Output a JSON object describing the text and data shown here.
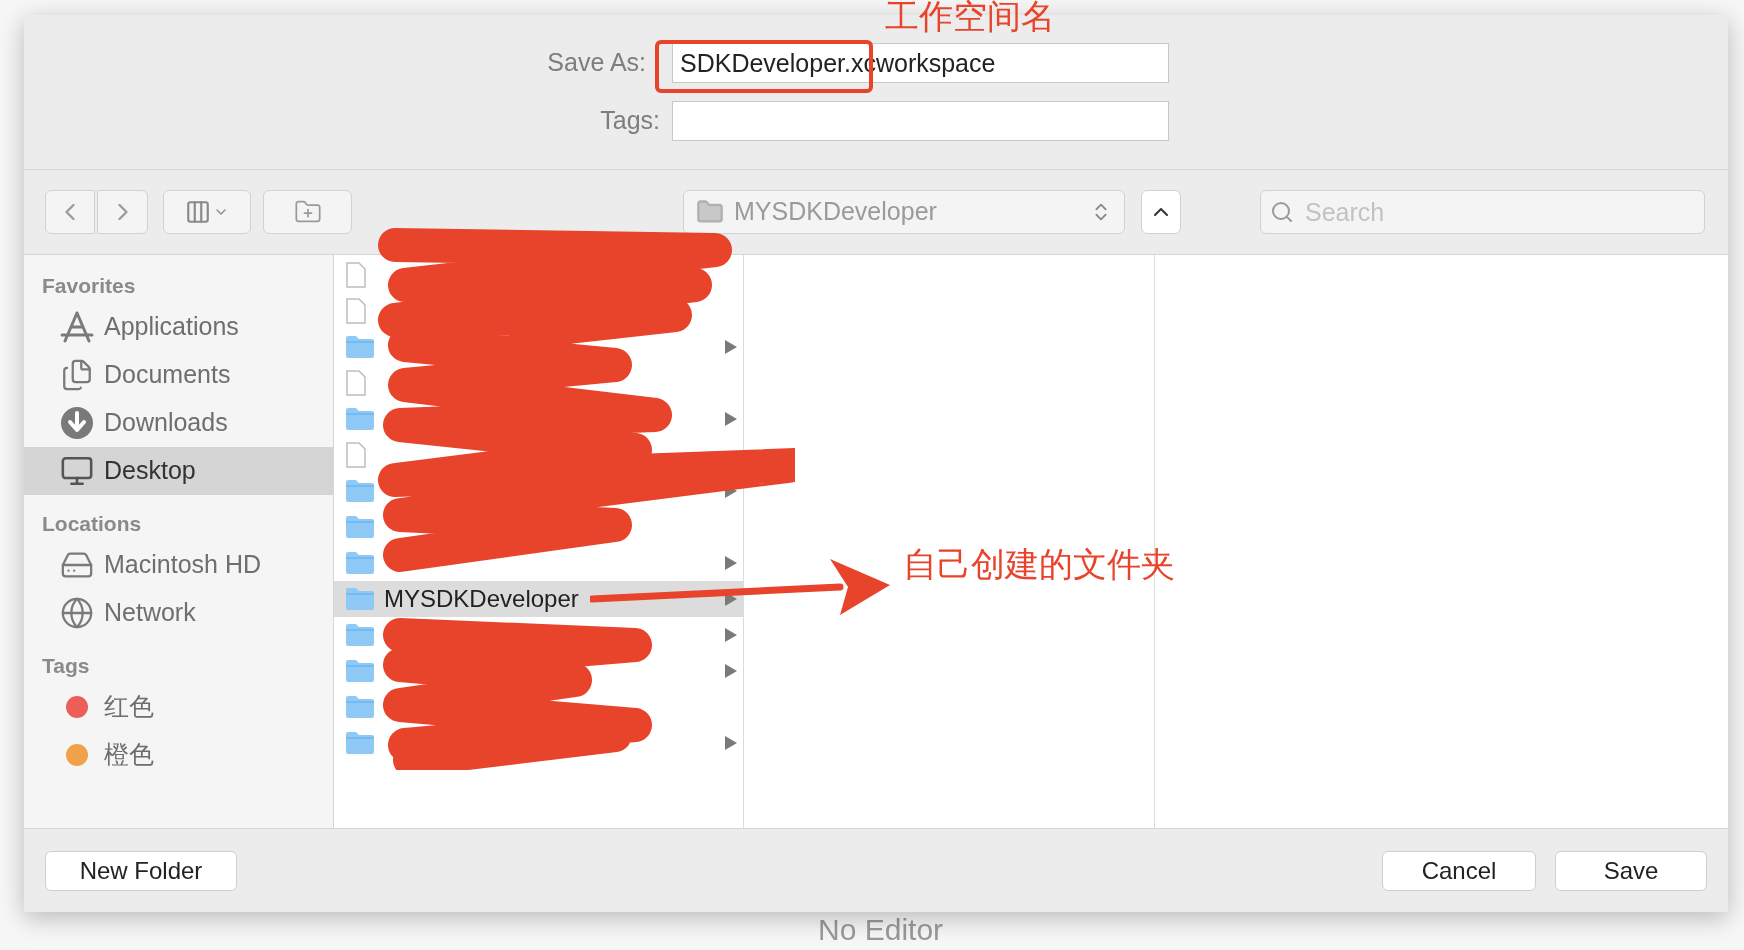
{
  "background": {
    "editor_message": "No Editor"
  },
  "dialog": {
    "save_as": {
      "label": "Save As:",
      "value": "SDKDeveloper.xcworkspace"
    },
    "tags_field": {
      "label": "Tags:"
    },
    "toolbar": {
      "location": "MYSDKDeveloper",
      "search": {
        "placeholder": "Search"
      }
    },
    "sidebar": [
      {
        "title": "Favorites",
        "items": [
          {
            "label": "Applications",
            "kind": "applications",
            "selected": false
          },
          {
            "label": "Documents",
            "kind": "documents",
            "selected": false
          },
          {
            "label": "Downloads",
            "kind": "downloads",
            "selected": false
          },
          {
            "label": "Desktop",
            "kind": "desktop",
            "selected": true
          }
        ]
      },
      {
        "title": "Locations",
        "items": [
          {
            "label": "Macintosh HD",
            "kind": "disk",
            "selected": false
          },
          {
            "label": "Network",
            "kind": "network",
            "selected": false
          }
        ]
      },
      {
        "title": "Tags",
        "items": [
          {
            "label": "红色",
            "kind": "tag",
            "color": "#ec5f57",
            "selected": false
          },
          {
            "label": "橙色",
            "kind": "tag",
            "color": "#f0a14a",
            "selected": false
          }
        ]
      }
    ],
    "file_rows": [
      {
        "kind": "file",
        "expandable": false,
        "selected": false
      },
      {
        "kind": "file",
        "expandable": false,
        "selected": false
      },
      {
        "kind": "folder",
        "expandable": true,
        "selected": false
      },
      {
        "kind": "file",
        "expandable": false,
        "selected": false
      },
      {
        "kind": "folder",
        "expandable": true,
        "selected": false
      },
      {
        "kind": "file",
        "expandable": false,
        "selected": false
      },
      {
        "kind": "folder",
        "expandable": true,
        "selected": false
      },
      {
        "kind": "folder",
        "expandable": false,
        "selected": false
      },
      {
        "kind": "folder",
        "expandable": true,
        "selected": false
      },
      {
        "kind": "folder",
        "name": "MYSDKDeveloper",
        "expandable": true,
        "selected": true
      },
      {
        "kind": "folder",
        "expandable": true,
        "selected": false
      },
      {
        "kind": "folder",
        "expandable": true,
        "selected": false
      },
      {
        "kind": "folder",
        "expandable": false,
        "selected": false
      },
      {
        "kind": "folder",
        "expandable": true,
        "selected": false
      }
    ],
    "buttons": {
      "new_folder": "New Folder",
      "cancel": "Cancel",
      "save": "Save"
    }
  },
  "annotations": [
    {
      "kind": "box",
      "text": "工作空间名"
    },
    {
      "kind": "arrow",
      "text": "自己创建的文件夹"
    }
  ]
}
